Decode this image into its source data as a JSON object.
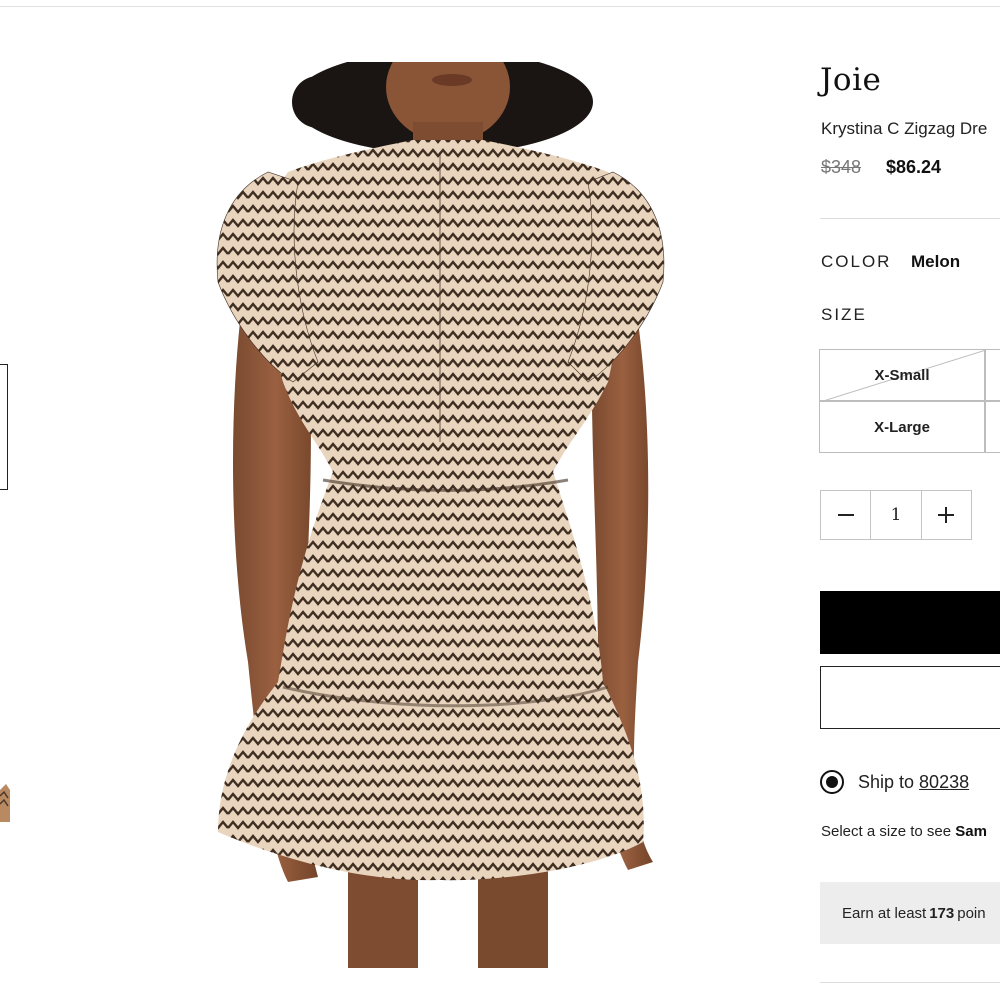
{
  "product": {
    "brand": "Joie",
    "name": "Krystina C Zigzag Dre",
    "price_original": "$348",
    "price_sale": "$86.24"
  },
  "color": {
    "label": "COLOR",
    "value": "Melon"
  },
  "size": {
    "label": "SIZE",
    "options": [
      {
        "label": "X-Small",
        "available": false
      },
      {
        "label": "X-Large",
        "available": true
      }
    ]
  },
  "quantity": {
    "value": "1",
    "decrement_icon": "minus-icon",
    "increment_icon": "plus-icon"
  },
  "shipping": {
    "text": "Ship to",
    "zip": "80238"
  },
  "size_note": {
    "text": "Select a size to see ",
    "bold": "Sam"
  },
  "rewards": {
    "prefix": "Earn at least ",
    "points": "173",
    "suffix": " poin"
  },
  "colors": {
    "accent": "#000000",
    "panel": "#ededed",
    "border": "#bdbdbd"
  }
}
